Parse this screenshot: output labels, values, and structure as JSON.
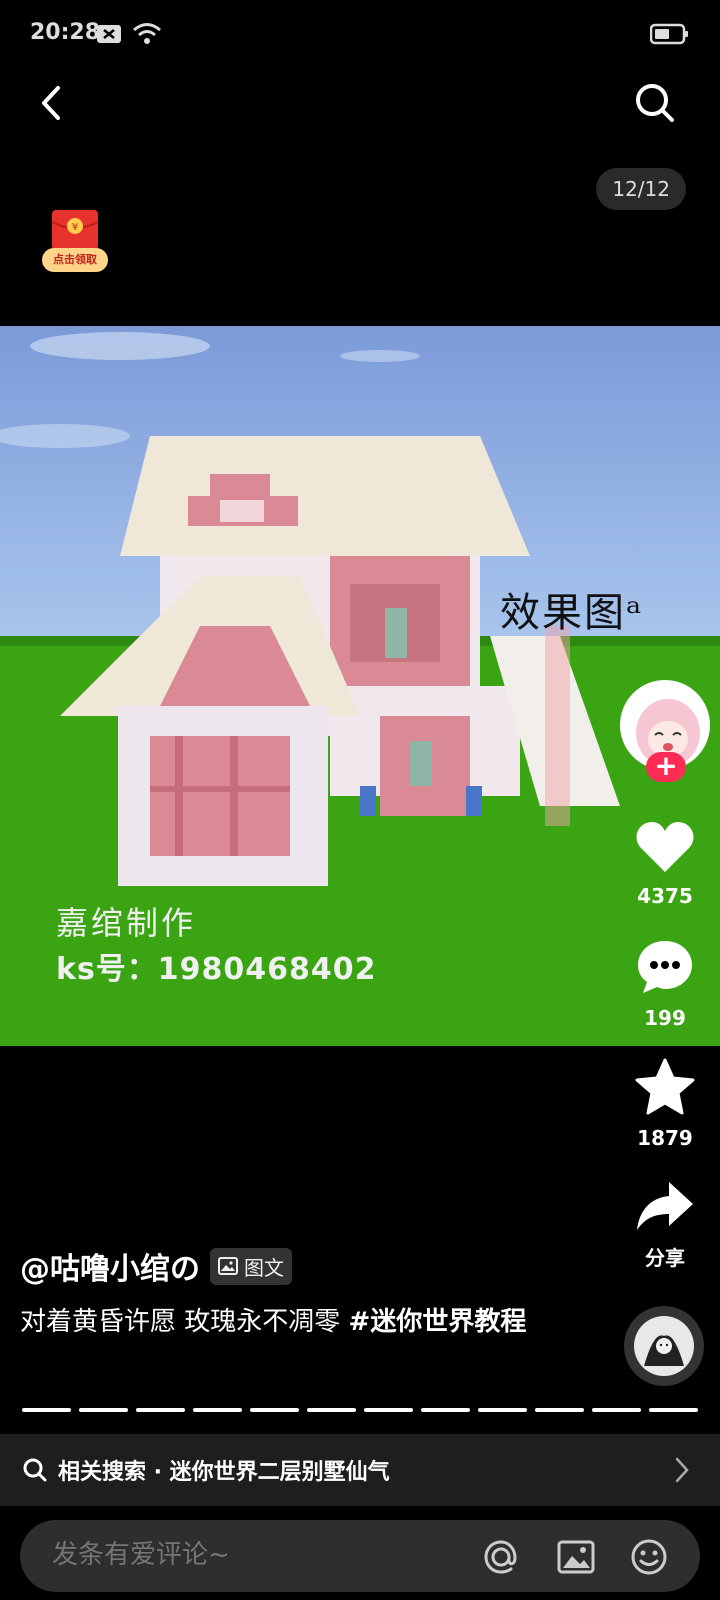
{
  "status": {
    "time": "20:28"
  },
  "post": {
    "page_counter": "12/12",
    "red_packet_label": "点击领取",
    "image_effect_label": "效果图ᵃ",
    "watermark_line1": "嘉绾制作",
    "watermark_line2": "ks号：1980468402",
    "author": "@咕噜小绾の",
    "type_badge": "图文",
    "caption_text": "对着黄昏许愿 玫瑰永不凋零 ",
    "caption_hashtag": "#迷你世界教程",
    "progress_segments": 12,
    "progress_current": 12
  },
  "actions": {
    "likes": "4375",
    "comments": "199",
    "favorites": "1879",
    "share": "分享"
  },
  "related_search": {
    "label": "相关搜索 · 迷你世界二层别墅仙气"
  },
  "comment": {
    "placeholder": "发条有爱评论~"
  },
  "icons": [
    "back-icon",
    "search-icon",
    "heart-icon",
    "comment-icon",
    "star-icon",
    "share-icon",
    "at-icon",
    "image-icon",
    "emoji-icon"
  ],
  "colors": {
    "accent": "#fe2c55",
    "background": "#000000"
  }
}
